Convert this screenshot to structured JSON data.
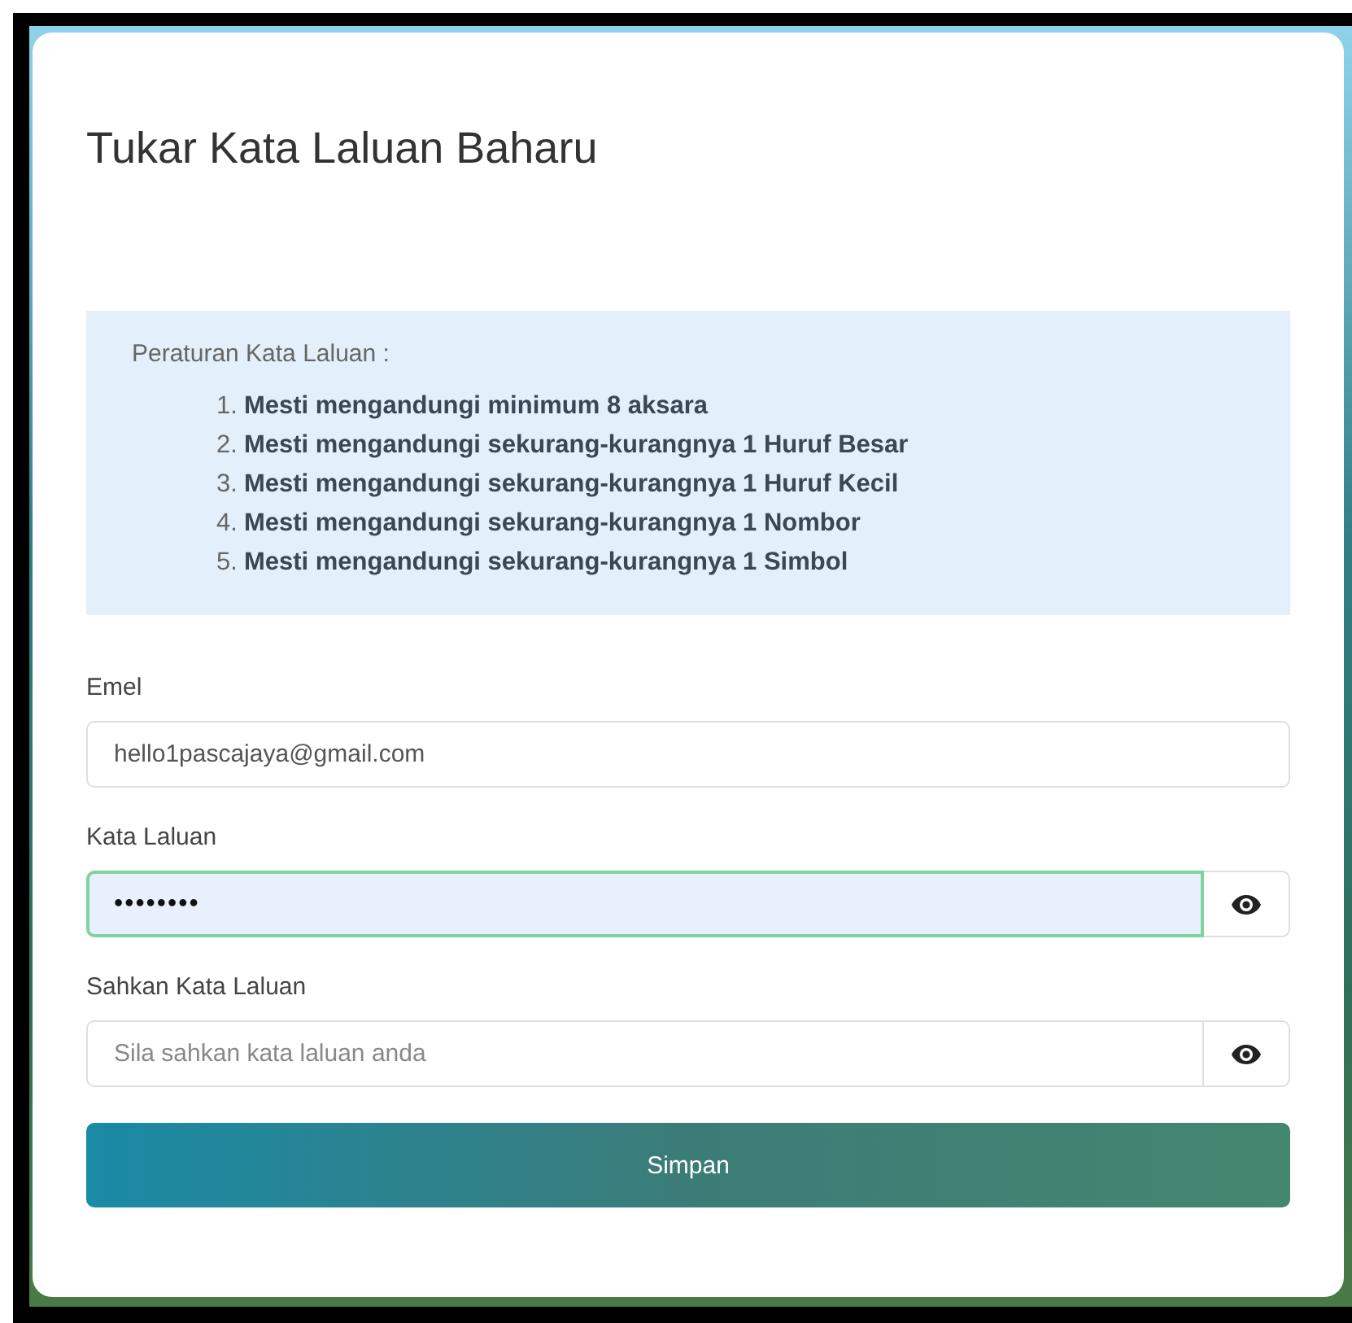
{
  "title": "Tukar Kata Laluan Baharu",
  "rules": {
    "heading": "Peraturan Kata Laluan :",
    "items": [
      {
        "number": "1.",
        "text": "Mesti mengandungi minimum 8 aksara"
      },
      {
        "number": "2.",
        "text": "Mesti mengandungi sekurang-kurangnya 1 Huruf Besar"
      },
      {
        "number": "3.",
        "text": "Mesti mengandungi sekurang-kurangnya 1 Huruf Kecil"
      },
      {
        "number": "4.",
        "text": "Mesti mengandungi sekurang-kurangnya 1 Nombor"
      },
      {
        "number": "5.",
        "text": "Mesti mengandungi sekurang-kurangnya 1 Simbol"
      }
    ]
  },
  "fields": [
    {
      "label": "Emel",
      "kind": "text",
      "value": "hello1pascajaya@gmail.com",
      "focused": false
    },
    {
      "label": "Kata Laluan",
      "kind": "password",
      "value": "••••••••",
      "focused": true
    },
    {
      "label": "Sahkan Kata Laluan",
      "kind": "password",
      "placeholder": "Sila sahkan kata laluan anda",
      "focused": false
    }
  ],
  "submit_button": "Simpan"
}
